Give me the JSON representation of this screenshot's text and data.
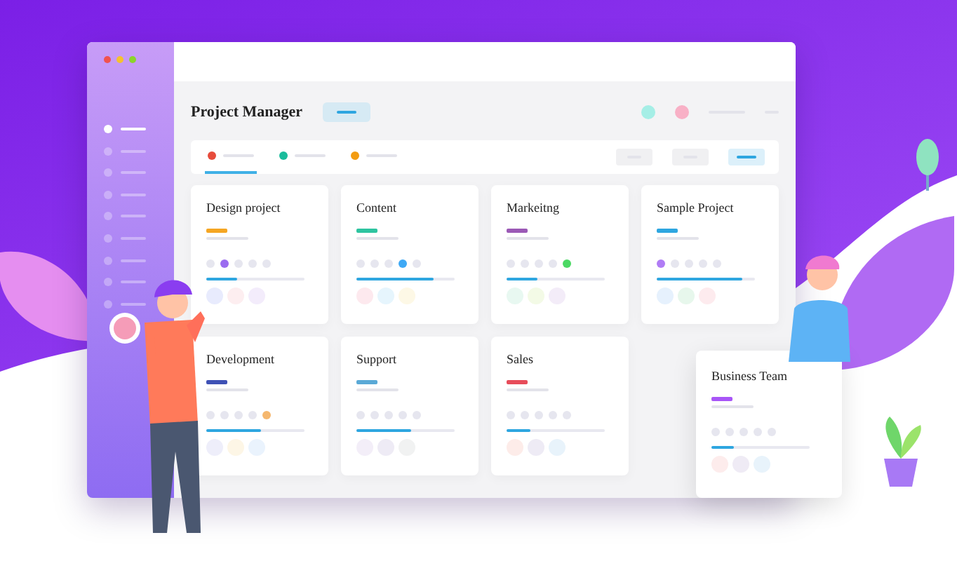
{
  "window": {
    "title": "Project Manager"
  },
  "sidebar": {
    "items": [
      {
        "selected": true
      },
      {
        "selected": false
      },
      {
        "selected": false
      },
      {
        "selected": false
      },
      {
        "selected": false
      },
      {
        "selected": false
      },
      {
        "selected": false
      },
      {
        "selected": false
      },
      {
        "selected": false
      }
    ]
  },
  "tabs": [
    {
      "color": "#e74c3c",
      "selected": true
    },
    {
      "color": "#1abc9c",
      "selected": false
    },
    {
      "color": "#f39c12",
      "selected": false
    }
  ],
  "cards": [
    {
      "title": "Design project",
      "color": "#f5a623",
      "level": 0.32,
      "dots": [
        {
          "color": "#e6e6ef"
        },
        {
          "color": "#9b6cf0"
        },
        {
          "color": "#e6e6ef"
        },
        {
          "color": "#e6e6ef"
        },
        {
          "color": "#e6e6ef"
        }
      ],
      "avatars": [
        {
          "color": "#e8ebfd"
        },
        {
          "color": "#fdeef0"
        },
        {
          "color": "#f3ecfb"
        }
      ]
    },
    {
      "title": "Content",
      "color": "#2ec4a0",
      "level": 0.79,
      "dots": [
        {
          "color": "#e6e6ef"
        },
        {
          "color": "#e6e6ef"
        },
        {
          "color": "#e6e6ef"
        },
        {
          "color": "#3fa9f5"
        },
        {
          "color": "#e6e6ef"
        }
      ],
      "avatars": [
        {
          "color": "#fde9ee"
        },
        {
          "color": "#e6f5fd"
        },
        {
          "color": "#fdf8e6"
        }
      ]
    },
    {
      "title": "Markeitng",
      "color": "#9b59b6",
      "level": 0.32,
      "dots": [
        {
          "color": "#e6e6ef"
        },
        {
          "color": "#e6e6ef"
        },
        {
          "color": "#e6e6ef"
        },
        {
          "color": "#e6e6ef"
        },
        {
          "color": "#4cd964"
        }
      ],
      "avatars": [
        {
          "color": "#e8f8f1"
        },
        {
          "color": "#f3fae6"
        },
        {
          "color": "#f3ecf8"
        }
      ]
    },
    {
      "title": "Sample Project",
      "color": "#2ea6e0",
      "level": 0.87,
      "dots": [
        {
          "color": "#b07cf5"
        },
        {
          "color": "#e6e6ef"
        },
        {
          "color": "#e6e6ef"
        },
        {
          "color": "#e6e6ef"
        },
        {
          "color": "#e6e6ef"
        }
      ],
      "avatars": [
        {
          "color": "#e6f1fd"
        },
        {
          "color": "#e7f7ec"
        },
        {
          "color": "#fdebee"
        }
      ]
    },
    {
      "title": "Development",
      "color": "#3f51b5",
      "level": 0.55,
      "dots": [
        {
          "color": "#e6e6ef"
        },
        {
          "color": "#e6e6ef"
        },
        {
          "color": "#e6e6ef"
        },
        {
          "color": "#e6e6ef"
        },
        {
          "color": "#f5b76e"
        }
      ],
      "avatars": [
        {
          "color": "#eeeefa"
        },
        {
          "color": "#fdf6e6"
        },
        {
          "color": "#eaf3fd"
        }
      ]
    },
    {
      "title": "Support",
      "color": "#5aa9d6",
      "level": 0.55,
      "dots": [
        {
          "color": "#e6e6ef"
        },
        {
          "color": "#e6e6ef"
        },
        {
          "color": "#e6e6ef"
        },
        {
          "color": "#e6e6ef"
        },
        {
          "color": "#e6e6ef"
        }
      ],
      "avatars": [
        {
          "color": "#f3eef8"
        },
        {
          "color": "#eeebf5"
        },
        {
          "color": "#f1f2f2"
        }
      ]
    },
    {
      "title": "Sales",
      "color": "#e74c5a",
      "level": 0.24,
      "dots": [
        {
          "color": "#e6e6ef"
        },
        {
          "color": "#e6e6ef"
        },
        {
          "color": "#e6e6ef"
        },
        {
          "color": "#e6e6ef"
        },
        {
          "color": "#e6e6ef"
        }
      ],
      "avatars": [
        {
          "color": "#fdece9"
        },
        {
          "color": "#eeebf5"
        },
        {
          "color": "#e8f3fb"
        }
      ]
    }
  ],
  "floating_card": {
    "title": "Business Team",
    "color": "#a855f7",
    "level": 0.23,
    "dots": [
      {
        "color": "#e6e6ef"
      },
      {
        "color": "#e6e6ef"
      },
      {
        "color": "#e6e6ef"
      },
      {
        "color": "#e6e6ef"
      },
      {
        "color": "#e6e6ef"
      }
    ],
    "avatars": [
      {
        "color": "#fdecec"
      },
      {
        "color": "#efebf5"
      },
      {
        "color": "#e8f3fb"
      }
    ]
  }
}
